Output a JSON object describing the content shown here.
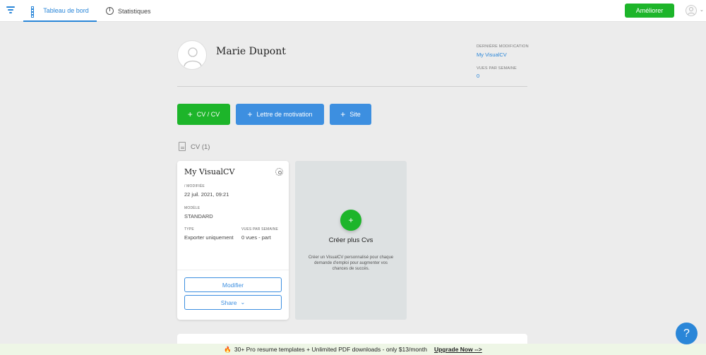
{
  "nav": {
    "tabs": [
      {
        "label": "Tableau de bord",
        "icon": "grid-icon",
        "active": true
      },
      {
        "label": "Statistiques",
        "icon": "pie-chart-icon",
        "active": false
      }
    ],
    "upgrade_label": "Améliorer"
  },
  "profile": {
    "name": "Marie Dupont",
    "last_modified_label": "DERNIÈRE MODIFICATION",
    "last_modified_value": "My VisualCV",
    "weekly_views_label": "VUES PAR SEMAINE",
    "weekly_views_value": "0"
  },
  "actions": {
    "cv": "CV / CV",
    "lettre": "Lettre de motivation",
    "site": "Site"
  },
  "section": {
    "title": "CV (1)"
  },
  "cv_card": {
    "title": "My VisualCV",
    "modified_label": "/ MODIFIÉE",
    "modified_value": "22 juil. 2021, 09:21",
    "model_label": "MODÈLE",
    "model_value": "STANDARD",
    "type_label": "TYPE",
    "type_value": "Exporter uniquement",
    "views_label": "VUES PAR SEMAINE",
    "views_value": "0 vues - part",
    "edit_label": "Modifier",
    "share_label": "Share"
  },
  "create_card": {
    "title": "Créer plus Cvs",
    "plus": "+",
    "description": "Créer un VisualCV personnalisé pour chaque demande d'emploi pour augmenter vos chances de succès."
  },
  "promo": {
    "text": "30+ Pro resume templates + Unlimited PDF downloads - only $13/month",
    "link": "Upgrade Now -->"
  },
  "help": "?",
  "colors": {
    "accent_blue": "#2a86d8",
    "green": "#1db52a"
  }
}
